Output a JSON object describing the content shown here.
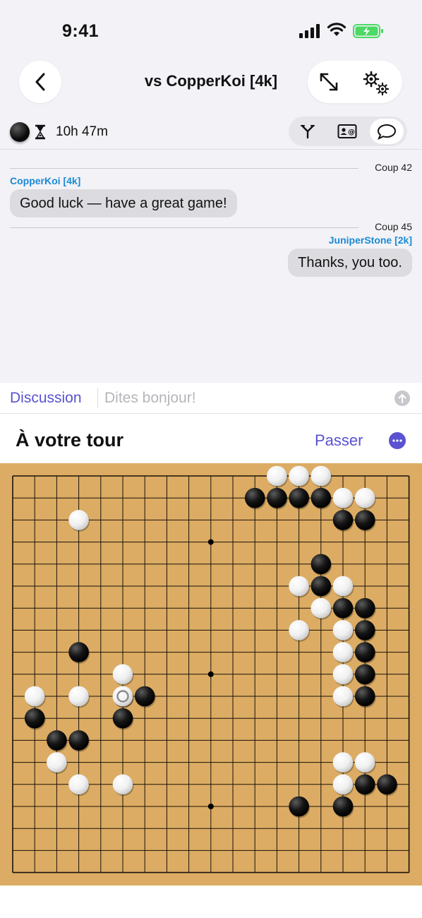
{
  "status": {
    "time": "9:41"
  },
  "header": {
    "title": "vs CopperKoi [4k]"
  },
  "player": {
    "time_left": "10h 47m"
  },
  "chat": {
    "messages": [
      {
        "move_label": "Coup 42",
        "sender": "CopperKoi [4k]",
        "text": "Good luck — have a great game!",
        "side": "left"
      },
      {
        "move_label": "Coup 45",
        "sender": "JuniperStone [2k]",
        "text": "Thanks, you too.",
        "side": "right"
      }
    ],
    "tab_label": "Discussion",
    "input_placeholder": "Dites bonjour!"
  },
  "turn": {
    "text": "À votre tour",
    "pass_label": "Passer"
  },
  "board": {
    "size": 19,
    "star_points": [
      [
        9,
        3
      ],
      [
        9,
        9
      ],
      [
        9,
        15
      ]
    ],
    "last_move": [
      5,
      10
    ],
    "stones": [
      {
        "c": "w",
        "x": 12,
        "y": 0
      },
      {
        "c": "w",
        "x": 13,
        "y": 0
      },
      {
        "c": "w",
        "x": 14,
        "y": 0
      },
      {
        "c": "b",
        "x": 11,
        "y": 1
      },
      {
        "c": "b",
        "x": 12,
        "y": 1
      },
      {
        "c": "b",
        "x": 13,
        "y": 1
      },
      {
        "c": "b",
        "x": 14,
        "y": 1
      },
      {
        "c": "w",
        "x": 15,
        "y": 1
      },
      {
        "c": "w",
        "x": 16,
        "y": 1
      },
      {
        "c": "w",
        "x": 3,
        "y": 2
      },
      {
        "c": "b",
        "x": 15,
        "y": 2
      },
      {
        "c": "b",
        "x": 16,
        "y": 2
      },
      {
        "c": "b",
        "x": 14,
        "y": 4
      },
      {
        "c": "w",
        "x": 13,
        "y": 5
      },
      {
        "c": "b",
        "x": 14,
        "y": 5
      },
      {
        "c": "w",
        "x": 15,
        "y": 5
      },
      {
        "c": "w",
        "x": 14,
        "y": 6
      },
      {
        "c": "b",
        "x": 15,
        "y": 6
      },
      {
        "c": "b",
        "x": 16,
        "y": 6
      },
      {
        "c": "w",
        "x": 13,
        "y": 7
      },
      {
        "c": "w",
        "x": 15,
        "y": 7
      },
      {
        "c": "b",
        "x": 16,
        "y": 7
      },
      {
        "c": "b",
        "x": 3,
        "y": 8
      },
      {
        "c": "w",
        "x": 15,
        "y": 8
      },
      {
        "c": "b",
        "x": 16,
        "y": 8
      },
      {
        "c": "w",
        "x": 5,
        "y": 9
      },
      {
        "c": "w",
        "x": 15,
        "y": 9
      },
      {
        "c": "b",
        "x": 16,
        "y": 9
      },
      {
        "c": "w",
        "x": 1,
        "y": 10
      },
      {
        "c": "w",
        "x": 3,
        "y": 10
      },
      {
        "c": "w",
        "x": 5,
        "y": 10
      },
      {
        "c": "b",
        "x": 6,
        "y": 10
      },
      {
        "c": "w",
        "x": 15,
        "y": 10
      },
      {
        "c": "b",
        "x": 16,
        "y": 10
      },
      {
        "c": "b",
        "x": 1,
        "y": 11
      },
      {
        "c": "b",
        "x": 5,
        "y": 11
      },
      {
        "c": "b",
        "x": 2,
        "y": 12
      },
      {
        "c": "b",
        "x": 3,
        "y": 12
      },
      {
        "c": "w",
        "x": 2,
        "y": 13
      },
      {
        "c": "w",
        "x": 15,
        "y": 13
      },
      {
        "c": "w",
        "x": 16,
        "y": 13
      },
      {
        "c": "w",
        "x": 3,
        "y": 14
      },
      {
        "c": "w",
        "x": 5,
        "y": 14
      },
      {
        "c": "w",
        "x": 15,
        "y": 14
      },
      {
        "c": "b",
        "x": 16,
        "y": 14
      },
      {
        "c": "b",
        "x": 17,
        "y": 14
      },
      {
        "c": "b",
        "x": 13,
        "y": 15
      },
      {
        "c": "b",
        "x": 15,
        "y": 15
      }
    ]
  },
  "colors": {
    "accent": "#5a52d0",
    "sender_name": "#1a8ad4",
    "board": "#dcac64"
  }
}
